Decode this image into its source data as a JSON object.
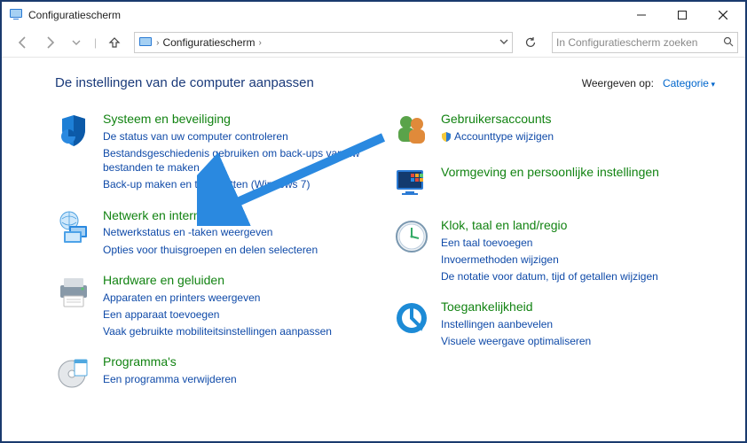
{
  "window": {
    "title": "Configuratiescherm"
  },
  "breadcrumb": {
    "root": "Configuratiescherm"
  },
  "search": {
    "placeholder": "In Configuratiescherm zoeken"
  },
  "header": {
    "heading": "De instellingen van de computer aanpassen",
    "view_by_label": "Weergeven op:",
    "view_by_value": "Categorie"
  },
  "left": {
    "system": {
      "title": "Systeem en beveiliging",
      "l1": "De status van uw computer controleren",
      "l2": "Bestandsgeschiedenis gebruiken om back-ups van uw bestanden te maken",
      "l3": "Back-up maken en terugzetten (Windows 7)"
    },
    "network": {
      "title": "Netwerk en internet",
      "l1": "Netwerkstatus en -taken weergeven",
      "l2": "Opties voor thuisgroepen en delen selecteren"
    },
    "hardware": {
      "title": "Hardware en geluiden",
      "l1": "Apparaten en printers weergeven",
      "l2": "Een apparaat toevoegen",
      "l3": "Vaak gebruikte mobiliteitsinstellingen aanpassen"
    },
    "programs": {
      "title": "Programma's",
      "l1": "Een programma verwijderen"
    }
  },
  "right": {
    "users": {
      "title": "Gebruikersaccounts",
      "l1": "Accounttype wijzigen"
    },
    "appearance": {
      "title": "Vormgeving en persoonlijke instellingen"
    },
    "clock": {
      "title": "Klok, taal en land/regio",
      "l1": "Een taal toevoegen",
      "l2": "Invoermethoden wijzigen",
      "l3": "De notatie voor datum, tijd of getallen wijzigen"
    },
    "ease": {
      "title": "Toegankelijkheid",
      "l1": "Instellingen aanbevelen",
      "l2": "Visuele weergave optimaliseren"
    }
  }
}
